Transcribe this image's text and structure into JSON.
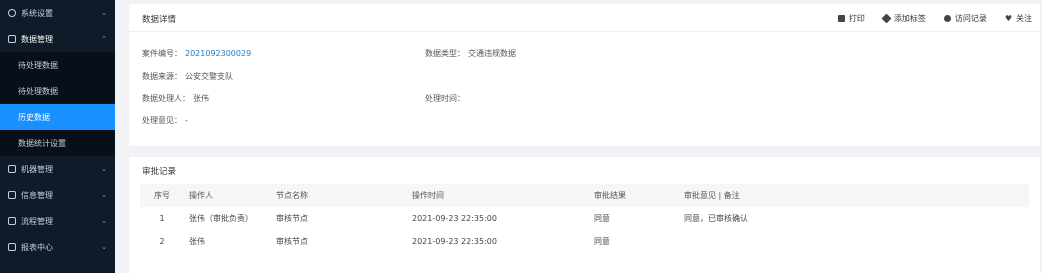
{
  "sidebar": {
    "items": [
      {
        "label": "系统设置",
        "icon": "settings-icon",
        "expanded": false
      },
      {
        "label": "数据管理",
        "icon": "data-icon",
        "expanded": true,
        "children": [
          {
            "label": "待处理数据"
          },
          {
            "label": "待处理数据"
          },
          {
            "label": "历史数据",
            "active": true
          },
          {
            "label": "数据统计设置"
          }
        ]
      },
      {
        "label": "机器管理",
        "icon": "machine-icon",
        "expanded": false
      },
      {
        "label": "信息管理",
        "icon": "info-icon",
        "expanded": false
      },
      {
        "label": "流程管理",
        "icon": "flow-icon",
        "expanded": false
      },
      {
        "label": "报表中心",
        "icon": "report-icon",
        "expanded": false
      }
    ]
  },
  "detail": {
    "title": "数据详情",
    "actions": [
      {
        "label": "打印",
        "icon": "print-icon"
      },
      {
        "label": "添加标签",
        "icon": "tag-icon"
      },
      {
        "label": "访问记录",
        "icon": "eye-icon"
      },
      {
        "label": "关注",
        "icon": "heart-icon"
      }
    ],
    "fields": {
      "number_label": "案件编号：",
      "number_value": "2021092300029",
      "type_label": "数据类型：",
      "type_value": "交通违规数据",
      "source_label": "数据来源：",
      "source_value": "公安交警支队",
      "handler_label": "数据处理人：",
      "handler_value": "张伟",
      "handle_time_label": "处理时间：",
      "handle_time_value": "",
      "result_label": "处理意见：",
      "result_value": "-"
    }
  },
  "log": {
    "title": "审批记录",
    "columns": [
      "序号",
      "操作人",
      "节点名称",
      "操作时间",
      "审批结果",
      "审批意见 | 备注"
    ],
    "rows": [
      [
        "1",
        "张伟（审批负责）",
        "审核节点",
        "2021-09-23 22:35:00",
        "同意",
        "同意，已审核确认"
      ],
      [
        "2",
        "张伟",
        "审核节点",
        "2021-09-23 22:35:00",
        "同意",
        ""
      ]
    ]
  }
}
